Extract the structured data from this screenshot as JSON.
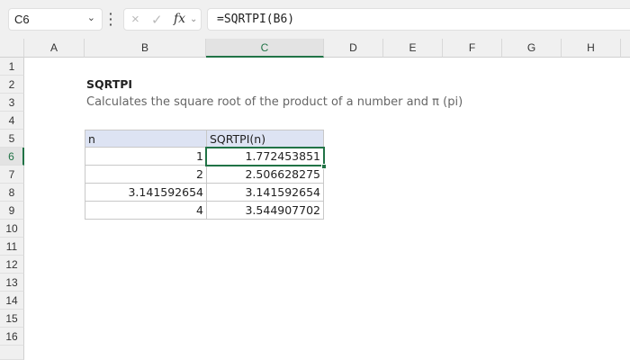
{
  "formula_bar": {
    "name_box": "C6",
    "formula": "=SQRTPI(B6)",
    "cancel_icon": "×",
    "enter_icon": "✓",
    "fx_label": "fx"
  },
  "columns": [
    "A",
    "B",
    "C",
    "D",
    "E",
    "F",
    "G",
    "H"
  ],
  "rows": [
    "1",
    "2",
    "3",
    "4",
    "5",
    "6",
    "7",
    "8",
    "9",
    "10",
    "11",
    "12",
    "13",
    "14",
    "15",
    "16"
  ],
  "selected": {
    "column": "C",
    "row": "6"
  },
  "sheet": {
    "title": "SQRTPI",
    "description": "Calculates the square root of the product of a number and π (pi)",
    "table": {
      "headers": [
        "n",
        "SQRTPI(n)"
      ],
      "rows": [
        [
          "1",
          "1.772453851"
        ],
        [
          "2",
          "2.506628275"
        ],
        [
          "3.141592654",
          "3.141592654"
        ],
        [
          "4",
          "3.544907702"
        ]
      ]
    }
  }
}
